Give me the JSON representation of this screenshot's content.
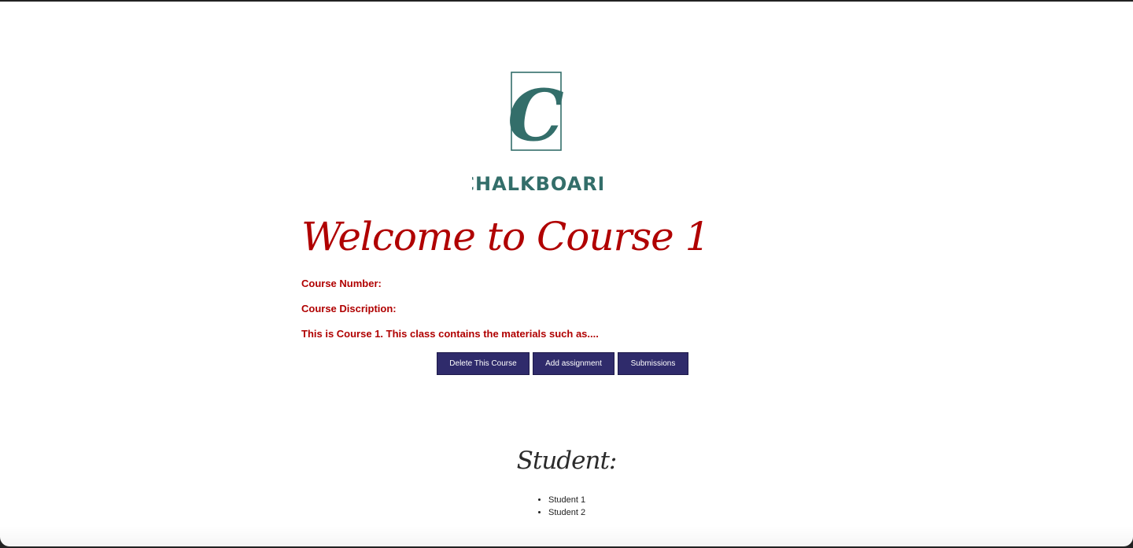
{
  "brand": {
    "logo_letter": "C",
    "logo_name": "CHALKBOARD",
    "color": "#336e6a"
  },
  "course": {
    "heading": "Welcome to Course 1",
    "number_label": "Course Number:",
    "description_label": "Course Discription:",
    "description_text": "This is Course 1. This class contains the materials such as....",
    "accent_color": "#b00000"
  },
  "actions": {
    "delete_label": "Delete This Course",
    "add_assignment_label": "Add assignment",
    "submissions_label": "Submissions",
    "button_color": "#2f2b6b"
  },
  "students": {
    "heading": "Student:",
    "items": [
      {
        "name": "Student 1"
      },
      {
        "name": "Student 2"
      }
    ]
  }
}
